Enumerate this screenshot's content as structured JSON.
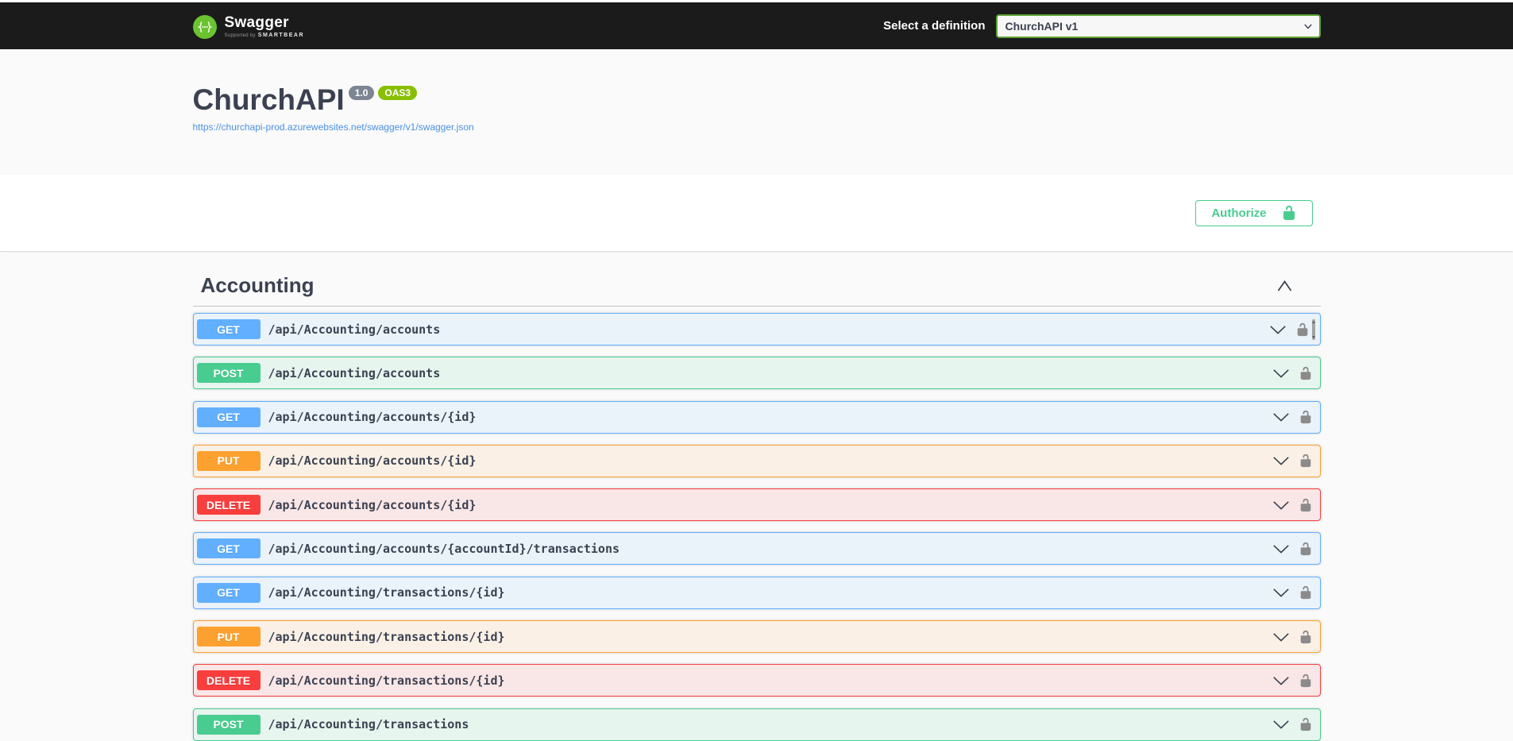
{
  "topbar": {
    "logo": {
      "brand": "Swagger",
      "brand_mark": "{···}",
      "supported_by": "Supported by",
      "smartbear": "SMARTBEAR"
    },
    "definition_label": "Select a definition",
    "definition_value": "ChurchAPI v1"
  },
  "info": {
    "title": "ChurchAPI",
    "version_badge": "1.0",
    "oas_badge": "OAS3",
    "spec_url": "https://churchapi-prod.azurewebsites.net/swagger/v1/swagger.json"
  },
  "auth": {
    "authorize_label": "Authorize"
  },
  "section": {
    "name": "Accounting",
    "operations": [
      {
        "method": "GET",
        "path": "/api/Accounting/accounts",
        "mini_scrollbar": true
      },
      {
        "method": "POST",
        "path": "/api/Accounting/accounts"
      },
      {
        "method": "GET",
        "path": "/api/Accounting/accounts/{id}"
      },
      {
        "method": "PUT",
        "path": "/api/Accounting/accounts/{id}"
      },
      {
        "method": "DELETE",
        "path": "/api/Accounting/accounts/{id}"
      },
      {
        "method": "GET",
        "path": "/api/Accounting/accounts/{accountId}/transactions"
      },
      {
        "method": "GET",
        "path": "/api/Accounting/transactions/{id}"
      },
      {
        "method": "PUT",
        "path": "/api/Accounting/transactions/{id}"
      },
      {
        "method": "DELETE",
        "path": "/api/Accounting/transactions/{id}"
      },
      {
        "method": "POST",
        "path": "/api/Accounting/transactions"
      }
    ]
  },
  "colors": {
    "get": "#61affe",
    "post": "#49cc90",
    "put": "#fca130",
    "delete": "#f93e3e",
    "topbar_bg": "#1b1b1b",
    "brand_green": "#6ac32f",
    "select_border_green": "#5ba237",
    "authorize_green": "#49cc90",
    "link_blue": "#4990e2",
    "version_pill_gray": "#7d8492",
    "oas_pill_green": "#89bf04",
    "text": "#3b4151"
  }
}
